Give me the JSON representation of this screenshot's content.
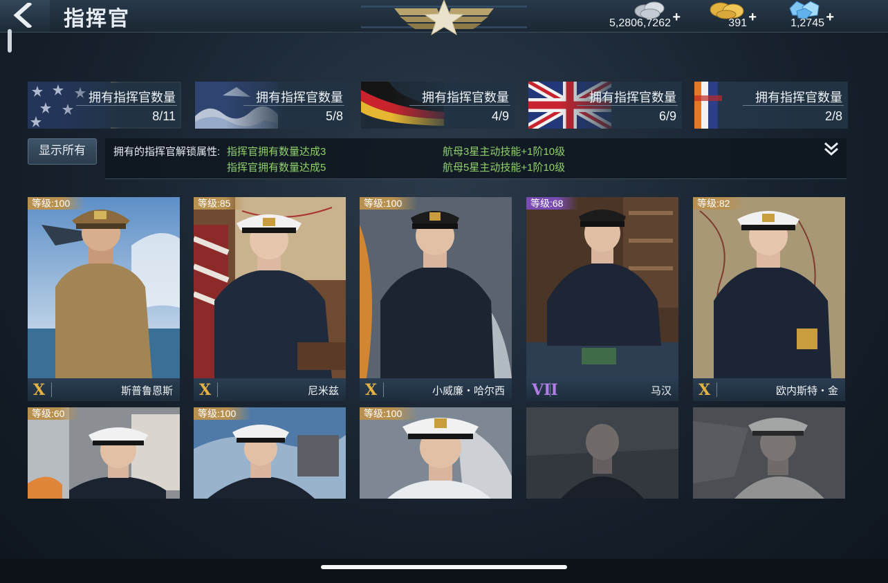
{
  "header": {
    "title": "指挥官",
    "resources": [
      {
        "name": "silver",
        "value": "5,2806,7262",
        "plus": "+"
      },
      {
        "name": "gold",
        "value": "391",
        "plus": "+"
      },
      {
        "name": "diamond",
        "value": "1,2745",
        "plus": "+"
      }
    ]
  },
  "tabs": [
    {
      "nation": "usa",
      "label": "拥有指挥官数量",
      "count": "8/11",
      "selected": true
    },
    {
      "nation": "japan",
      "label": "拥有指挥官数量",
      "count": "5/8",
      "selected": false
    },
    {
      "nation": "germany",
      "label": "拥有指挥官数量",
      "count": "4/9",
      "selected": false
    },
    {
      "nation": "uk",
      "label": "拥有指挥官数量",
      "count": "6/9",
      "selected": false
    },
    {
      "nation": "other",
      "label": "拥有指挥官数量",
      "count": "2/8",
      "selected": false
    }
  ],
  "show_all": "显示所有",
  "info": {
    "heading": "拥有的指挥官解锁属性:",
    "rows": [
      {
        "cond": "指挥官拥有数量达成3",
        "effect": "航母3星主动技能+1阶10级"
      },
      {
        "cond": "指挥官拥有数量达成5",
        "effect": "航母5星主动技能+1阶10级"
      }
    ],
    "expand_icon": "double-chevron-down-icon"
  },
  "commanders": [
    {
      "level": "等级:100",
      "rank": "X",
      "name": "斯普鲁恩斯",
      "tier": "gold"
    },
    {
      "level": "等级:85",
      "rank": "X",
      "name": "尼米兹",
      "tier": "gold"
    },
    {
      "level": "等级:100",
      "rank": "X",
      "name": "小威廉・哈尔西",
      "tier": "gold"
    },
    {
      "level": "等级:68",
      "rank": "VII",
      "name": "马汉",
      "tier": "purple"
    },
    {
      "level": "等级:82",
      "rank": "X",
      "name": "欧内斯特・金",
      "tier": "gold"
    },
    {
      "level": "等级:60",
      "rank": "",
      "name": "",
      "tier": "gold"
    },
    {
      "level": "等级:100",
      "rank": "",
      "name": "",
      "tier": "gold"
    },
    {
      "level": "等级:100",
      "rank": "",
      "name": "",
      "tier": "gold"
    },
    {
      "level": "",
      "rank": "",
      "name": "",
      "tier": "locked"
    },
    {
      "level": "",
      "rank": "",
      "name": "",
      "tier": "locked"
    }
  ],
  "colors": {
    "accent_gold": "#b89150",
    "accent_purple": "#7a4bb3",
    "green_text": "#8fd16a"
  }
}
